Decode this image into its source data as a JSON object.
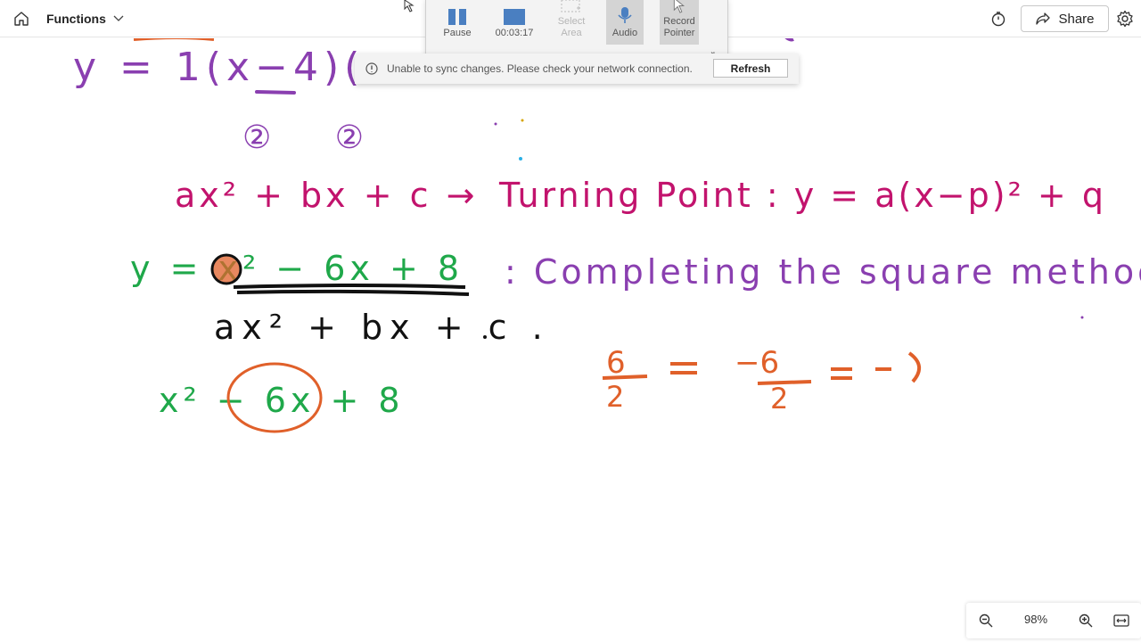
{
  "header": {
    "title": "Functions",
    "share_label": "Share",
    "icons": [
      "home-icon",
      "chevron-down-icon",
      "timer-icon",
      "share-icon",
      "gear-icon"
    ]
  },
  "recorder": {
    "pause_label": "Pause",
    "time": "00:03:17",
    "select_area_label": "Select\nArea",
    "audio_label": "Audio",
    "record_pointer_label": "Record\nPointer"
  },
  "notification": {
    "message": "Unable to sync changes. Please check your network connection.",
    "refresh_label": "Refresh"
  },
  "ink": {
    "line1": "y = 1(x−4)(",
    "line2": "② ②",
    "line3_left": "ax² + bx + c →",
    "line3_right": "Turning Point : y = a(x−p)² + q",
    "line4_left": "y = x² − 6x + 8",
    "line4_right": ": Completing the square method",
    "line5": "ax² + bx + c .",
    "line6": "x² − 6x + 8",
    "fraction_expr": "6/2 = −6/2 = −3",
    "frac1_num": "6",
    "frac1_den": "2",
    "frac2_num": "−6",
    "frac2_den": "2",
    "colors": {
      "purple": "#8a3fb0",
      "magenta": "#c2136d",
      "green": "#1fa84a",
      "black": "#111111",
      "orange": "#e0602a"
    }
  },
  "zoom": {
    "level": "98%"
  }
}
